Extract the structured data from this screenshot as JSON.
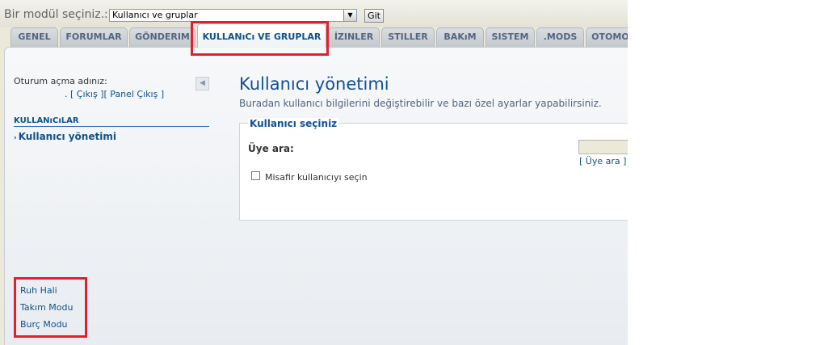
{
  "header": {
    "module_label": "Bir modül seçiniz.:",
    "module_select_value": "Kullanıcı ve gruplar",
    "go_label": "Git"
  },
  "tabs": [
    {
      "label": "GENEL"
    },
    {
      "label": "FORUMLAR"
    },
    {
      "label": "GÖNDERIM"
    },
    {
      "label": "KULLANıCı VE GRUPLAR",
      "active": true
    },
    {
      "label": "İZINLER"
    },
    {
      "label": "STILLER"
    },
    {
      "label": "BAKıM"
    },
    {
      "label": "SISTEM"
    },
    {
      "label": ".MODS"
    },
    {
      "label": "OTOMOD"
    }
  ],
  "sidebar": {
    "login_label": "Oturum açma adınız:",
    "login_links": ". [ Çıkış ][ Panel Çıkış ]",
    "collapse_icon": "◀",
    "section_title": "KULLANıCıLAR",
    "active_item": "Kullanıcı yönetimi",
    "extra_links": [
      "Ruh Hali",
      "Takım Modu",
      "Burç Modu"
    ]
  },
  "main": {
    "title": "Kullanıcı yönetimi",
    "description": "Buradan kullanıcı bilgilerini değiştirebilir ve bazı özel ayarlar yapabilirsiniz.",
    "fieldset_legend": "Kullanıcı seçiniz",
    "member_label": "Üye ara:",
    "member_search_link": "[ Üye ara ]",
    "guest_checkbox_label": "Misafir kullanıcıyı seçin"
  },
  "colors": {
    "accent": "#105289",
    "highlight": "#e0202f"
  }
}
